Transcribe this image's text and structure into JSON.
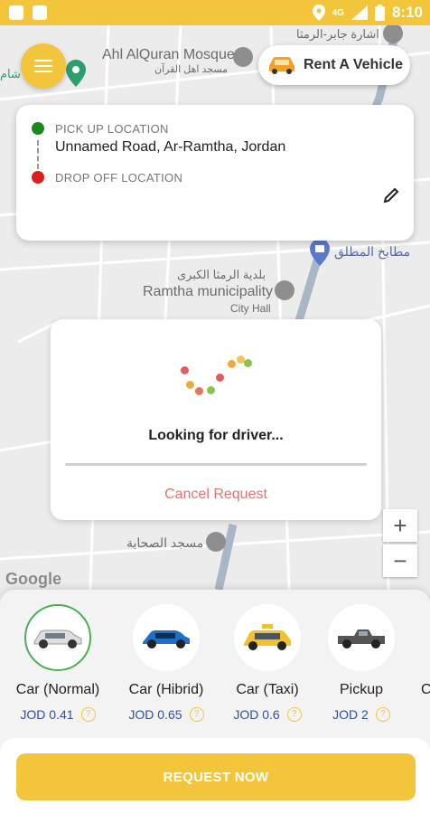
{
  "status_bar": {
    "time": "8:10",
    "signal": "4G"
  },
  "map": {
    "labels": {
      "mosque_en": "Ahl AlQuran Mosque",
      "mosque_ar": "مسجد اهل القرآن",
      "signal_ar": "اشارة جابر-الرمثا",
      "left_ar": "شام",
      "kitchen_ar": "مطابخ المطلق",
      "municipality_ar": "بلدية الرمثا الكبرى",
      "municipality_en": "Ramtha municipality",
      "city_hall": "City Hall",
      "sahaba_ar": "مسجد الصحابة"
    },
    "google_logo": "Google",
    "zoom_in": "+",
    "zoom_out": "−"
  },
  "rent_button": {
    "label": "Rent A Vehicle",
    "icon": "car-icon"
  },
  "location_card": {
    "pickup_label": "PICK UP LOCATION",
    "pickup_address": "Unnamed Road, Ar-Ramtha, Jordan",
    "dropoff_label": "DROP OFF LOCATION",
    "pickup_color": "#1a8a1a",
    "dropoff_color": "#e01b1b"
  },
  "loading_dialog": {
    "title": "Looking for driver...",
    "cancel_label": "Cancel Request"
  },
  "vehicles": [
    {
      "name": "Car (Normal)",
      "price": "JOD 0.41",
      "selected": true,
      "icon": "car-normal-icon"
    },
    {
      "name": "Car (Hibrid)",
      "price": "JOD 0.65",
      "selected": false,
      "icon": "car-hybrid-icon"
    },
    {
      "name": "Car (Taxi)",
      "price": "JOD 0.6",
      "selected": false,
      "icon": "taxi-icon"
    },
    {
      "name": "Pickup",
      "price": "JOD 2",
      "selected": false,
      "icon": "pickup-icon"
    },
    {
      "name": "C"
    }
  ],
  "request_button": {
    "label": "REQUEST NOW"
  },
  "colors": {
    "accent": "#f3c53a",
    "price": "#2f4fa0",
    "cancel": "#e57373",
    "selected_ring": "#4caf50"
  }
}
